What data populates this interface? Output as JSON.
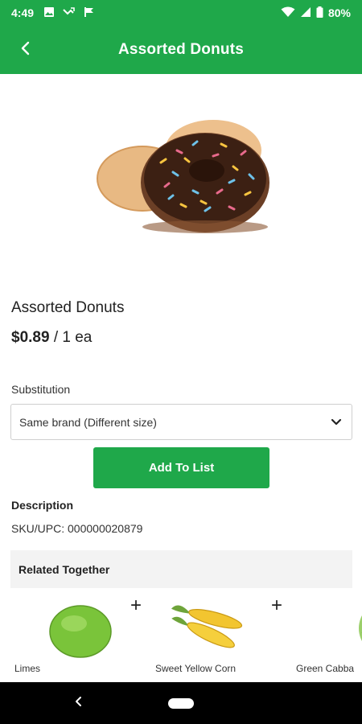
{
  "status_bar": {
    "time": "4:49",
    "battery": "80%",
    "icons": [
      "image-icon",
      "missed-call-icon",
      "flag-icon",
      "wifi-icon",
      "signal-icon",
      "battery-icon"
    ]
  },
  "app_bar": {
    "title": "Assorted Donuts",
    "back_icon": "chevron-left-icon"
  },
  "product": {
    "name": "Assorted Donuts",
    "price": "$0.89",
    "unit": " / 1 ea",
    "image": "donuts-image"
  },
  "substitution": {
    "label": "Substitution",
    "selected": "Same brand (Different size)"
  },
  "actions": {
    "add_to_list": "Add To List"
  },
  "description": {
    "title": "Description",
    "sku": "SKU/UPC: 000000020879"
  },
  "related": {
    "title": "Related Together",
    "items": [
      {
        "label": "Limes",
        "image": "lime-image"
      },
      {
        "label": "Sweet Yellow Corn",
        "image": "corn-image"
      },
      {
        "label": "Green Cabba",
        "image": "cabbage-image"
      }
    ],
    "add_symbol": "+"
  },
  "colors": {
    "brand_green": "#1fa84a",
    "nav_bar": "#000000"
  }
}
